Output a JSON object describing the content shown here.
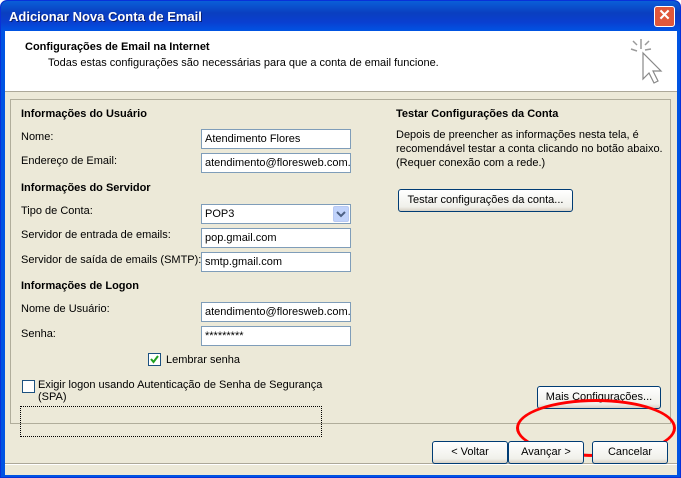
{
  "window": {
    "title": "Adicionar Nova Conta de Email",
    "close_label": "✕"
  },
  "header": {
    "title": "Configurações de Email na Internet",
    "subtitle": "Todas estas configurações são necessárias para que a conta de email funcione."
  },
  "user_info": {
    "section": "Informações do Usuário",
    "name_label": "Nome:",
    "name_value": "Atendimento Flores",
    "email_label": "Endereço de Email:",
    "email_value": "atendimento@floresweb.com."
  },
  "server_info": {
    "section": "Informações do Servidor",
    "account_type_label": "Tipo de Conta:",
    "account_type_value": "POP3",
    "incoming_label": "Servidor de entrada de emails:",
    "incoming_value": "pop.gmail.com",
    "outgoing_label": "Servidor de saída de emails (SMTP):",
    "outgoing_value": "smtp.gmail.com"
  },
  "logon_info": {
    "section": "Informações de Logon",
    "username_label": "Nome de Usuário:",
    "username_value": "atendimento@floresweb.com.",
    "password_label": "Senha:",
    "password_value": "*********",
    "remember_label": "Lembrar senha",
    "remember_checked": true,
    "spa_label_line1": "Exigir logon usando Autenticação de Senha de Segurança",
    "spa_label_line2": "(SPA)",
    "spa_checked": false
  },
  "test": {
    "section": "Testar Configurações da Conta",
    "description": "Depois de preencher as informações nesta tela, é recomendável testar a conta clicando no botão abaixo. (Requer conexão com a rede.)",
    "test_button": "Testar configurações da conta..."
  },
  "more_settings_button": "Mais Configurações...",
  "footer": {
    "back_button": "< Voltar",
    "next_button": "Avançar >",
    "cancel_button": "Cancelar"
  },
  "colors": {
    "highlight_ellipse": "#ff0000",
    "title_bar": "#0054e3"
  }
}
